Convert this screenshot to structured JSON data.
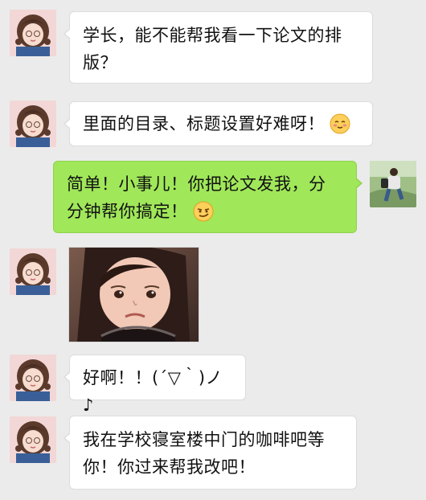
{
  "conversation": {
    "messages": [
      {
        "side": "left",
        "sender": "girl",
        "lines": [
          "学长，能不能帮我看一下论文的排",
          "版？"
        ]
      },
      {
        "side": "left",
        "sender": "girl",
        "lines": [
          "里面的目录、标题设置好难呀！"
        ],
        "emoji": "blushing-smile-emoji"
      },
      {
        "side": "right",
        "sender": "senior",
        "lines": [
          "简单！小事儿！你把论文发我，分",
          "分钟帮你搞定！"
        ],
        "emoji": "smirk-emoji"
      },
      {
        "side": "left",
        "sender": "girl",
        "type": "sticker",
        "sticker": "sad-little-girl-sticker"
      },
      {
        "side": "left",
        "sender": "girl",
        "lines": [
          "好啊！！(´▽｀)ノ♪"
        ]
      },
      {
        "side": "left",
        "sender": "girl",
        "lines": [
          "我在学校寝室楼中门的咖啡吧等",
          "你！你过来帮我改吧！"
        ]
      }
    ]
  },
  "colors": {
    "background": "#ebebeb",
    "bubble_left": "#ffffff",
    "bubble_right": "#a0e75a"
  }
}
